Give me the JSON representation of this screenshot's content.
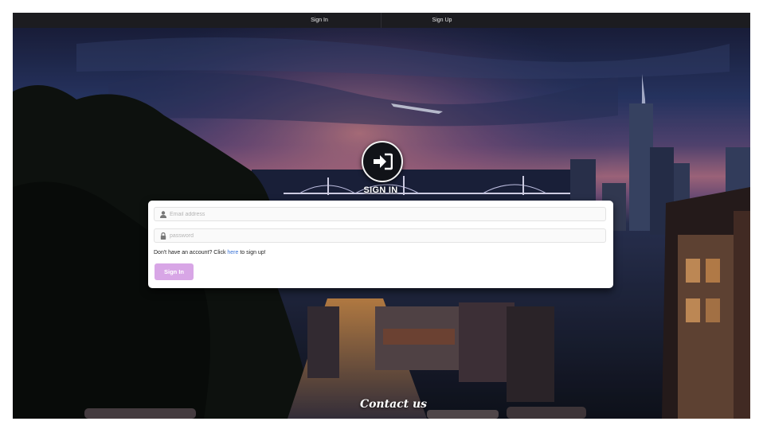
{
  "nav": {
    "signin_label": "Sign In",
    "signup_label": "Sign Up"
  },
  "hero": {
    "icon": "sign-in-arrow-icon",
    "title": "SIGN IN"
  },
  "form": {
    "email_placeholder": "Email address",
    "email_icon": "user-icon",
    "password_placeholder": "password",
    "password_icon": "lock-icon",
    "signup_prefix": "Don't have an account? Click ",
    "signup_link": "here",
    "signup_suffix": " to sign up!",
    "submit_label": "Sign In"
  },
  "footer": {
    "contact_label": "Contact us"
  },
  "colors": {
    "navbar": "#1c1c20",
    "button": "#d8a6e6",
    "link": "#3c74d6",
    "card": "#ffffff"
  }
}
